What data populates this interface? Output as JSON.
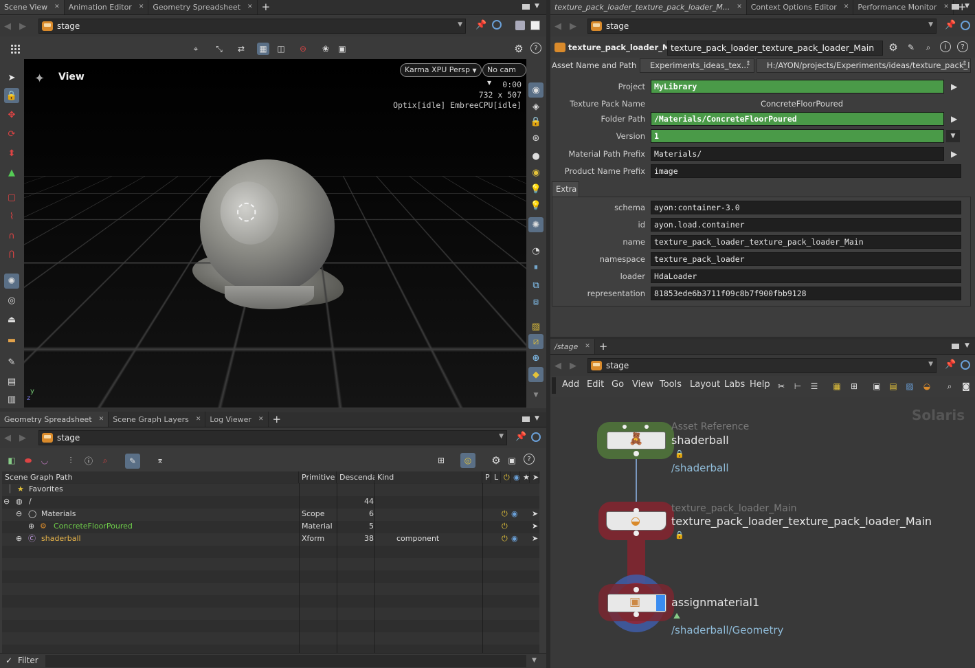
{
  "scene_view": {
    "tabs": [
      {
        "label": "Scene View",
        "active": true
      },
      {
        "label": "Animation Editor",
        "active": false
      },
      {
        "label": "Geometry Spreadsheet",
        "active": false
      }
    ],
    "path": "stage",
    "viewport": {
      "title": "View",
      "renderer": "Karma XPU Persp",
      "camera": "No cam",
      "time": "0:00",
      "resolution": "732 x 507",
      "engine_status": "Optix[idle] EmbreeCPU[idle]",
      "axis_y": "y",
      "axis_z": "z"
    }
  },
  "spreadsheet": {
    "tabs": [
      {
        "label": "Geometry Spreadsheet",
        "active": true
      },
      {
        "label": "Scene Graph Layers",
        "active": false
      },
      {
        "label": "Log Viewer",
        "active": false
      }
    ],
    "path": "stage",
    "columns": [
      "Scene Graph Path",
      "Primitive",
      "Descenda",
      "Kind",
      "P",
      "L"
    ],
    "rows": [
      {
        "name": "Favorites",
        "primitive": "",
        "descendants": "",
        "kind": ""
      },
      {
        "name": "/",
        "primitive": "",
        "descendants": "44",
        "kind": ""
      },
      {
        "name": "Materials",
        "primitive": "Scope",
        "descendants": "6",
        "kind": ""
      },
      {
        "name": "ConcreteFloorPoured",
        "primitive": "Material",
        "descendants": "5",
        "kind": ""
      },
      {
        "name": "shaderball",
        "primitive": "Xform",
        "descendants": "38",
        "kind": "component"
      }
    ],
    "filter_label": "Filter"
  },
  "parameters": {
    "tabs": [
      {
        "label": "texture_pack_loader_texture_pack_loader_M...",
        "active": true
      },
      {
        "label": "Context Options Editor",
        "active": false
      },
      {
        "label": "Performance Monitor",
        "active": false
      }
    ],
    "path": "stage",
    "node_type": "texture_pack_loader_Main",
    "node_name": "texture_pack_loader_texture_pack_loader_Main",
    "asset_label": "Asset Name and Path",
    "asset_name": "Experiments_ideas_tex...",
    "asset_path": "H:/AYON/projects/Experiments/ideas/texture_pack_l...",
    "fields": [
      {
        "label": "Project",
        "value": "MyLibrary"
      },
      {
        "label": "Texture Pack Name",
        "value": "ConcreteFloorPoured"
      },
      {
        "label": "Folder Path",
        "value": "/Materials/ConcreteFloorPoured"
      },
      {
        "label": "Version",
        "value": "1"
      },
      {
        "label": "Material Path Prefix",
        "value": "Materials/"
      },
      {
        "label": "Product Name Prefix",
        "value": "image"
      }
    ],
    "extra_tab": "Extra",
    "extra_fields": [
      {
        "label": "schema",
        "value": "ayon:container-3.0"
      },
      {
        "label": "id",
        "value": "ayon.load.container"
      },
      {
        "label": "name",
        "value": "texture_pack_loader_texture_pack_loader_Main"
      },
      {
        "label": "namespace",
        "value": "texture_pack_loader"
      },
      {
        "label": "loader",
        "value": "HdaLoader"
      },
      {
        "label": "representation",
        "value": "81853ede6b3711f09c8b7f900fbb9128"
      }
    ]
  },
  "network": {
    "tab": "/stage",
    "path": "stage",
    "menus": [
      "Add",
      "Edit",
      "Go",
      "View",
      "Tools",
      "Layout",
      "Labs",
      "Help"
    ],
    "context": "Solaris",
    "nodes": [
      {
        "type": "Asset Reference",
        "name": "shaderball",
        "detail": "/shaderball"
      },
      {
        "type": "texture_pack_loader_Main",
        "name": "texture_pack_loader_texture_pack_loader_Main",
        "detail": ""
      },
      {
        "type": "",
        "name": "assignmaterial1",
        "detail": "/shaderball/Geometry"
      }
    ]
  },
  "colors": {
    "green_field": "#4a9a48",
    "node_red": "#7a2730",
    "node_green": "#4d6e3a",
    "path_blue": "#8fbbd8"
  }
}
